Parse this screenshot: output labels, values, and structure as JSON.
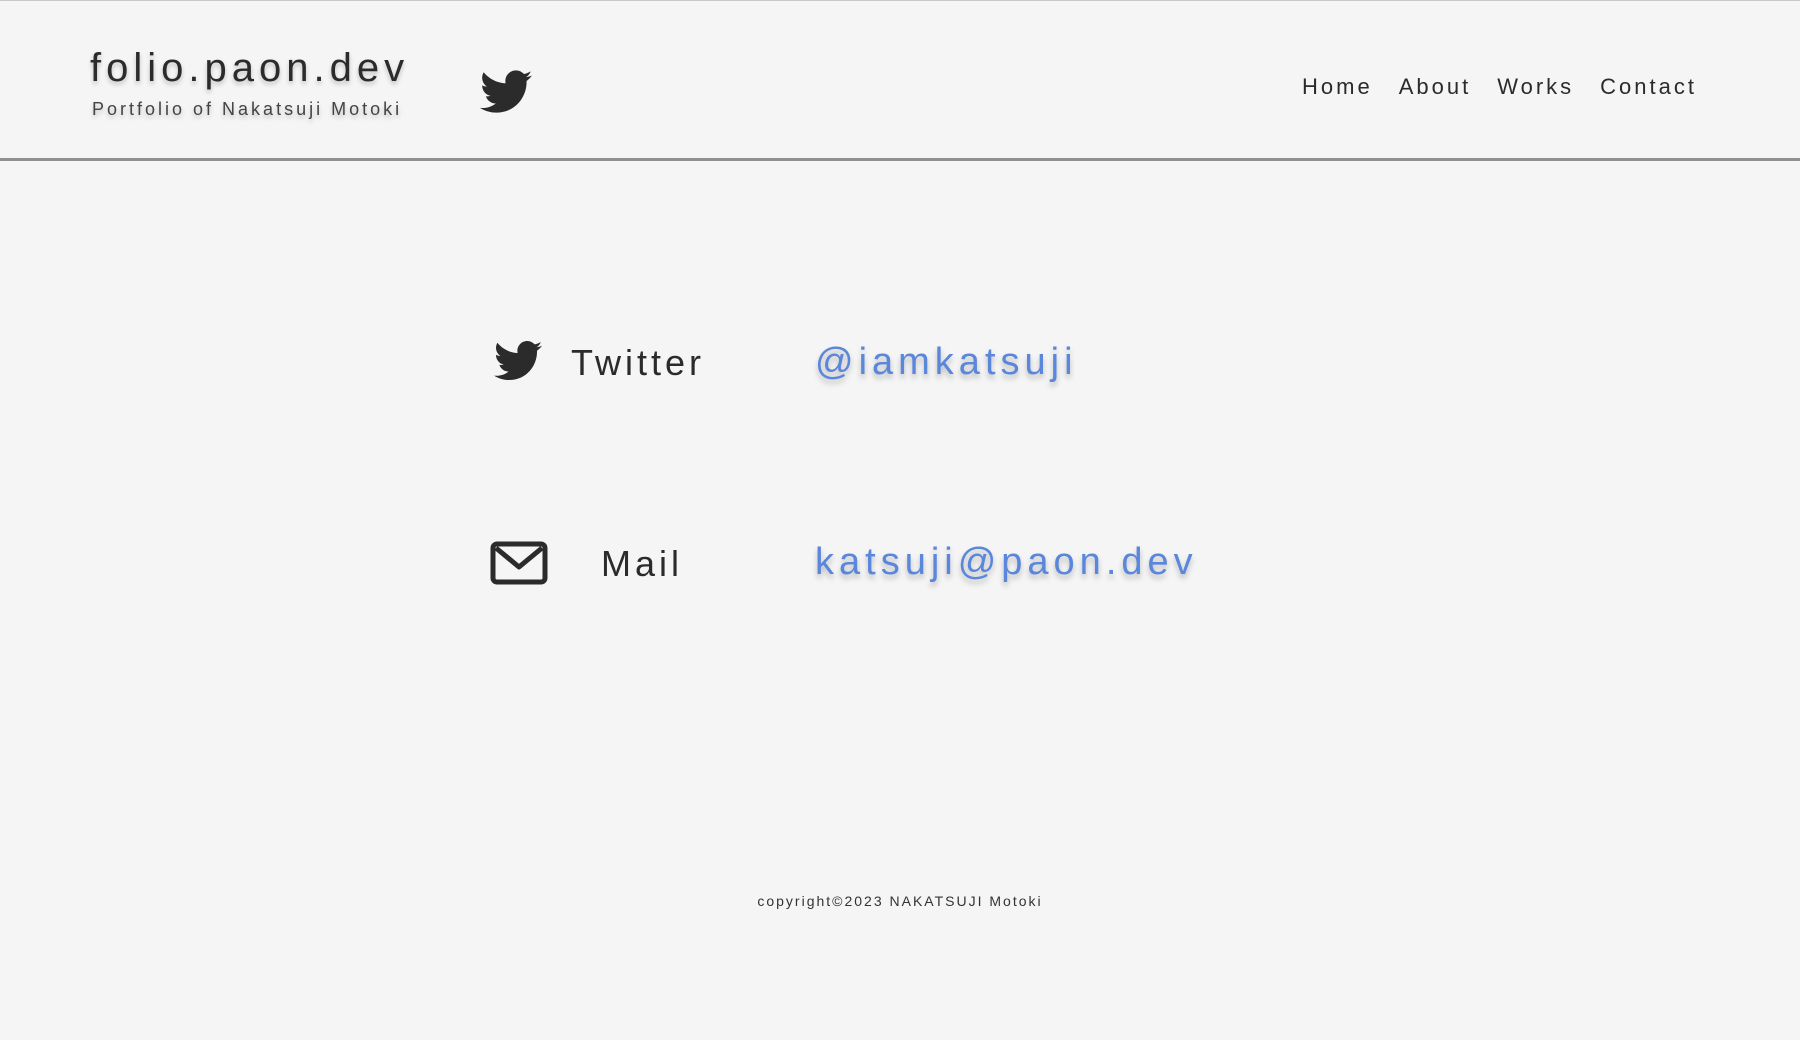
{
  "header": {
    "site_title": "folio.paon.dev",
    "site_subtitle": "Portfolio of Nakatsuji Motoki",
    "twitter_icon": "twitter-bird-icon",
    "nav": [
      {
        "label": "Home"
      },
      {
        "label": "About"
      },
      {
        "label": "Works"
      },
      {
        "label": "Contact"
      }
    ]
  },
  "contacts": [
    {
      "icon": "twitter-bird-icon",
      "label": "Twitter",
      "value": "@iamkatsuji"
    },
    {
      "icon": "mail-icon",
      "label": "Mail",
      "value": "katsuji@paon.dev"
    }
  ],
  "footer": {
    "copyright": "copyright©2023 NAKATSUJI Motoki"
  },
  "colors": {
    "background": "#f5f5f5",
    "text": "#2b2b2b",
    "link": "#5a86db",
    "divider": "#8f8f8f"
  }
}
